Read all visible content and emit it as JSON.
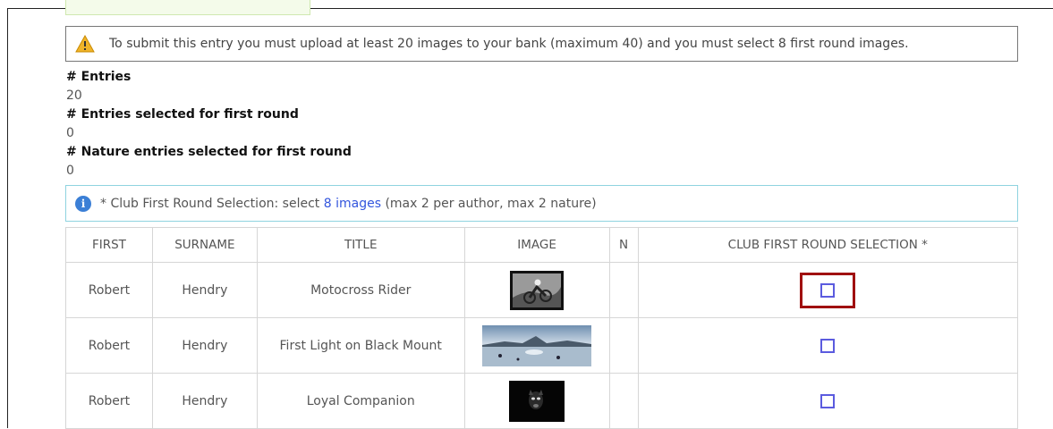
{
  "warning": {
    "icon": "warning-triangle-icon",
    "text": "To submit this entry you must upload at least 20 images to your bank (maximum 40) and you must select 8 first round images."
  },
  "stats": [
    {
      "label": "# Entries",
      "value": "20"
    },
    {
      "label": "# Entries selected for first round",
      "value": "0"
    },
    {
      "label": "# Nature entries selected for first round",
      "value": "0"
    }
  ],
  "info": {
    "icon": "info-circle-icon",
    "prefix": "* Club First Round Selection: select",
    "link": "8 images",
    "suffix": "(max 2 per author, max 2 nature)"
  },
  "table": {
    "headers": {
      "first": "FIRST",
      "surname": "SURNAME",
      "title": "TITLE",
      "image": "IMAGE",
      "n": "N",
      "selection": "CLUB FIRST ROUND SELECTION *"
    },
    "rows": [
      {
        "first": "Robert",
        "surname": "Hendry",
        "title": "Motocross Rider",
        "n": "",
        "selected": false
      },
      {
        "first": "Robert",
        "surname": "Hendry",
        "title": "First Light on Black Mount",
        "n": "",
        "selected": false
      },
      {
        "first": "Robert",
        "surname": "Hendry",
        "title": "Loyal Companion",
        "n": "",
        "selected": false
      }
    ]
  },
  "colors": {
    "checkbox": "#5b5bdf",
    "highlight": "#a01010",
    "link": "#3355dd",
    "info_border": "#8fd3e0"
  }
}
